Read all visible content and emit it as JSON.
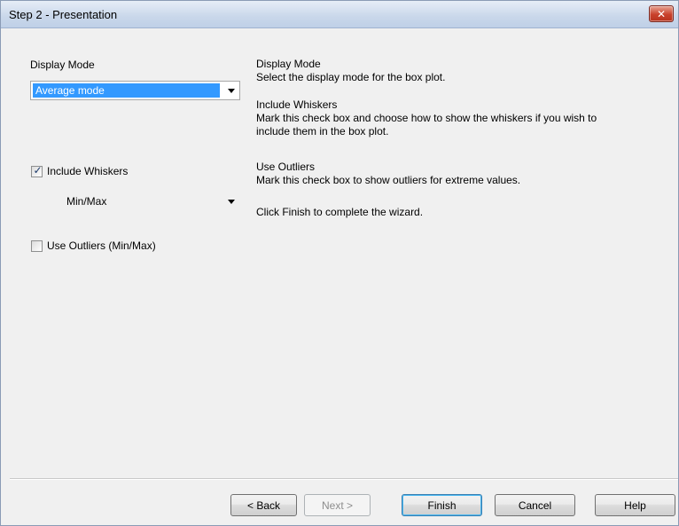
{
  "window": {
    "title": "Step 2 - Presentation",
    "close_icon": "close-icon"
  },
  "left": {
    "display_mode_label": "Display Mode",
    "display_mode_value": "Average mode",
    "include_whiskers_label": "Include Whiskers",
    "include_whiskers_checked": true,
    "whiskers_value": "Min/Max",
    "use_outliers_label": "Use Outliers (Min/Max)",
    "use_outliers_checked": false
  },
  "help": {
    "display_mode_title": "Display Mode",
    "display_mode_text": "Select the display mode for the box plot.",
    "include_whiskers_title": "Include Whiskers",
    "include_whiskers_text_1": "Mark this check box and choose how to show the whiskers if you wish to",
    "include_whiskers_text_2": "include them in the box plot.",
    "use_outliers_title": "Use Outliers",
    "use_outliers_text": "Mark this check box to show outliers for extreme values.",
    "finish_text": "Click Finish to complete the wizard."
  },
  "buttons": {
    "back": "< Back",
    "next": "Next >",
    "finish": "Finish",
    "cancel": "Cancel",
    "help": "Help"
  },
  "check_mark": "✓"
}
